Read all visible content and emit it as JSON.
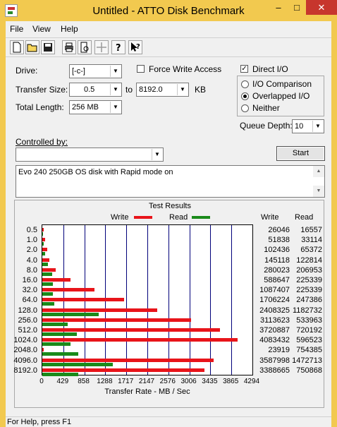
{
  "window": {
    "title": "Untitled - ATTO Disk Benchmark",
    "min": "–",
    "max": "□",
    "close": "✕"
  },
  "menu": [
    "File",
    "View",
    "Help"
  ],
  "toolbar": [
    "new-icon",
    "open-icon",
    "save-icon",
    "print-icon",
    "print-preview-icon",
    "move-icon",
    "help-icon",
    "context-help-icon"
  ],
  "form": {
    "drive_label": "Drive:",
    "drive_value": "[-c-]",
    "force_write_label": "Force Write Access",
    "force_write_checked": false,
    "direct_io_label": "Direct I/O",
    "direct_io_checked": true,
    "transfer_size_label": "Transfer Size:",
    "transfer_from": "0.5",
    "to_label": "to",
    "transfer_to": "8192.0",
    "kb_label": "KB",
    "total_length_label": "Total Length:",
    "total_length_value": "256 MB",
    "io_options": [
      {
        "label": "I/O Comparison",
        "selected": false
      },
      {
        "label": "Overlapped I/O",
        "selected": true
      },
      {
        "label": "Neither",
        "selected": false
      }
    ],
    "queue_depth_label": "Queue Depth:",
    "queue_depth_value": "10",
    "controlled_by_label": "Controlled by:",
    "controlled_by_value": "",
    "start_label": "Start",
    "description": "Evo 240 250GB OS disk with Rapid mode on"
  },
  "results": {
    "title": "Test Results",
    "legend_write": "Write",
    "legend_read": "Read",
    "col_write": "Write",
    "col_read": "Read",
    "xaxis_title": "Transfer Rate - MB / Sec"
  },
  "chart_data": {
    "type": "bar",
    "orientation": "horizontal",
    "title": "Test Results",
    "xlabel": "Transfer Rate - MB / Sec",
    "xlim": [
      0,
      4294
    ],
    "xticks": [
      "0",
      "429",
      "858",
      "1288",
      "1717",
      "2147",
      "2576",
      "3006",
      "3435",
      "3865",
      "4294"
    ],
    "categories": [
      "0.5",
      "1.0",
      "2.0",
      "4.0",
      "8.0",
      "16.0",
      "32.0",
      "64.0",
      "128.0",
      "256.0",
      "512.0",
      "1024.0",
      "2048.0",
      "4096.0",
      "8192.0"
    ],
    "series": [
      {
        "name": "Write",
        "color": "#e8141a",
        "values": [
          26046,
          51838,
          102436,
          145118,
          280023,
          588647,
          1087407,
          1706224,
          2408325,
          3113623,
          3720887,
          4083432,
          23919,
          3587998,
          3388665
        ]
      },
      {
        "name": "Read",
        "color": "#1a8a1a",
        "values": [
          16557,
          33114,
          65372,
          122814,
          206953,
          225339,
          225339,
          247386,
          1182732,
          533963,
          720192,
          596523,
          754385,
          1472713,
          750868
        ]
      }
    ]
  },
  "status": {
    "text": "For Help, press F1"
  }
}
